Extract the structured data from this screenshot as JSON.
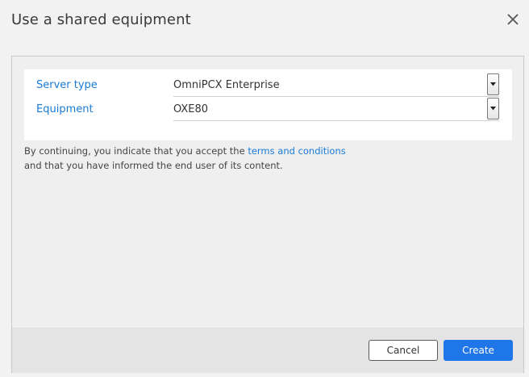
{
  "dialog": {
    "title": "Use a shared equipment",
    "close_icon": "close-icon"
  },
  "form": {
    "server_type": {
      "label": "Server type",
      "value": "OmniPCX Enterprise"
    },
    "equipment": {
      "label": "Equipment",
      "value": "OXE80"
    }
  },
  "terms": {
    "prefix": "By continuing, you indicate that you accept the ",
    "link": "terms and conditions",
    "suffix": "and that you have informed the end user of its content."
  },
  "buttons": {
    "cancel": "Cancel",
    "create": "Create"
  },
  "colors": {
    "accent": "#1e76e8",
    "label": "#1a7bd6",
    "background": "#f2f2f2"
  }
}
